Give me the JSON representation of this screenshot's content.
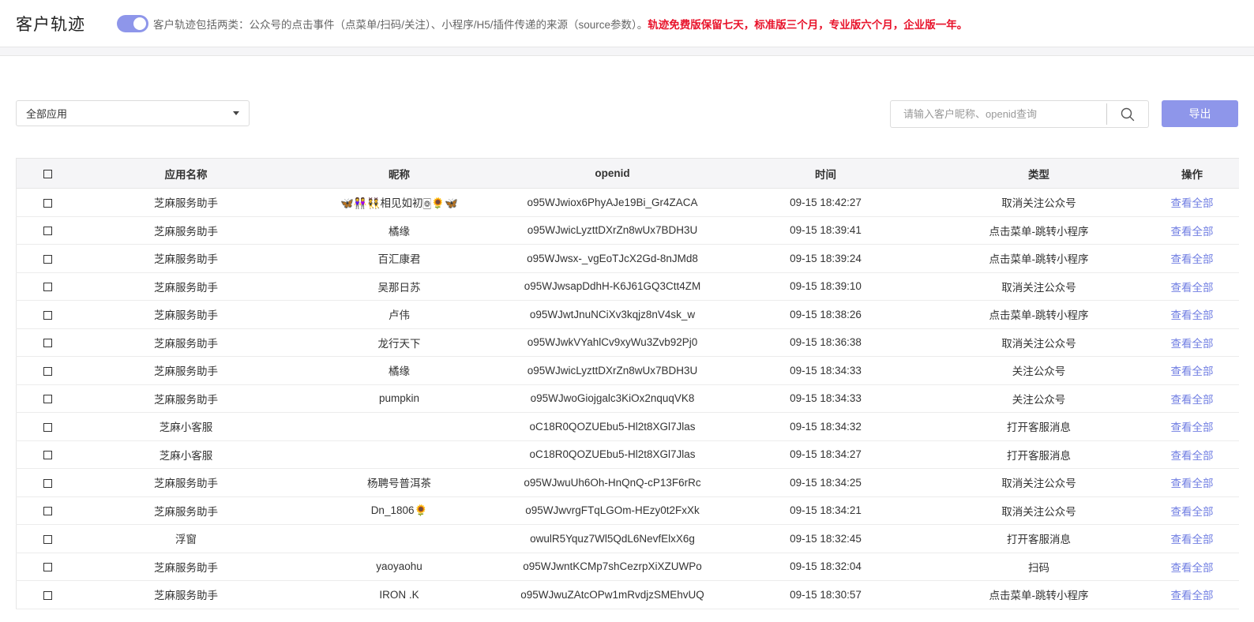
{
  "header": {
    "title": "客户轨迹",
    "notice_main": "客户轨迹包括两类：公众号的点击事件（点菜单/扫码/关注）、小程序/H5/插件传递的来源（source参数）。",
    "notice_red": "轨迹免费版保留七天，标准版三个月，专业版六个月，企业版一年。"
  },
  "toolbar": {
    "app_select_value": "全部应用",
    "search_placeholder": "请输入客户昵称、openid查询",
    "export_label": "导出"
  },
  "table": {
    "columns": [
      "应用名称",
      "昵称",
      "openid",
      "时间",
      "类型",
      "操作"
    ],
    "rows": [
      {
        "app": "芝麻服务助手",
        "nickname": "🦋👭👯相见如初🀙🌻🦋",
        "openid": "o95WJwiox6PhyAJe19Bi_Gr4ZACA",
        "time": "09-15 18:42:27",
        "type": "取消关注公众号",
        "action": "查看全部"
      },
      {
        "app": "芝麻服务助手",
        "nickname": "橘缘",
        "openid": "o95WJwicLyzttDXrZn8wUx7BDH3U",
        "time": "09-15 18:39:41",
        "type": "点击菜单-跳转小程序",
        "action": "查看全部"
      },
      {
        "app": "芝麻服务助手",
        "nickname": "百汇康君",
        "openid": "o95WJwsx-_vgEoTJcX2Gd-8nJMd8",
        "time": "09-15 18:39:24",
        "type": "点击菜单-跳转小程序",
        "action": "查看全部"
      },
      {
        "app": "芝麻服务助手",
        "nickname": "吴那日苏",
        "openid": "o95WJwsapDdhH-K6J61GQ3Ctt4ZM",
        "time": "09-15 18:39:10",
        "type": "取消关注公众号",
        "action": "查看全部"
      },
      {
        "app": "芝麻服务助手",
        "nickname": "卢伟",
        "openid": "o95WJwtJnuNCiXv3kqjz8nV4sk_w",
        "time": "09-15 18:38:26",
        "type": "点击菜单-跳转小程序",
        "action": "查看全部"
      },
      {
        "app": "芝麻服务助手",
        "nickname": "龙行天下",
        "openid": "o95WJwkVYahlCv9xyWu3Zvb92Pj0",
        "time": "09-15 18:36:38",
        "type": "取消关注公众号",
        "action": "查看全部"
      },
      {
        "app": "芝麻服务助手",
        "nickname": "橘缘",
        "openid": "o95WJwicLyzttDXrZn8wUx7BDH3U",
        "time": "09-15 18:34:33",
        "type": "关注公众号",
        "action": "查看全部"
      },
      {
        "app": "芝麻服务助手",
        "nickname": "pumpkin",
        "openid": "o95WJwoGiojgalc3KiOx2nquqVK8",
        "time": "09-15 18:34:33",
        "type": "关注公众号",
        "action": "查看全部"
      },
      {
        "app": "芝麻小客服",
        "nickname": "",
        "openid": "oC18R0QOZUEbu5-Hl2t8XGl7Jlas",
        "time": "09-15 18:34:32",
        "type": "打开客服消息",
        "action": "查看全部"
      },
      {
        "app": "芝麻小客服",
        "nickname": "",
        "openid": "oC18R0QOZUEbu5-Hl2t8XGl7Jlas",
        "time": "09-15 18:34:27",
        "type": "打开客服消息",
        "action": "查看全部"
      },
      {
        "app": "芝麻服务助手",
        "nickname": "杨聘号普洱茶",
        "openid": "o95WJwuUh6Oh-HnQnQ-cP13F6rRc",
        "time": "09-15 18:34:25",
        "type": "取消关注公众号",
        "action": "查看全部"
      },
      {
        "app": "芝麻服务助手",
        "nickname": "Dn_1806🌻",
        "openid": "o95WJwvrgFTqLGOm-HEzy0t2FxXk",
        "time": "09-15 18:34:21",
        "type": "取消关注公众号",
        "action": "查看全部"
      },
      {
        "app": "浮窗",
        "nickname": "",
        "openid": "owulR5Yquz7Wl5QdL6NevfElxX6g",
        "time": "09-15 18:32:45",
        "type": "打开客服消息",
        "action": "查看全部"
      },
      {
        "app": "芝麻服务助手",
        "nickname": "yaoyaohu",
        "openid": "o95WJwntKCMp7shCezrpXiXZUWPo",
        "time": "09-15 18:32:04",
        "type": "扫码",
        "action": "查看全部"
      },
      {
        "app": "芝麻服务助手",
        "nickname": "IRON .K",
        "openid": "o95WJwuZAtcOPw1mRvdjzSMEhvUQ",
        "time": "09-15 18:30:57",
        "type": "点击菜单-跳转小程序",
        "action": "查看全部"
      }
    ]
  },
  "colors": {
    "accent": "#8e96ea",
    "link": "#6f7de2",
    "warning": "#e8122a"
  },
  "icons": {
    "search": "search-icon",
    "dropdown": "chevron-down-icon"
  }
}
